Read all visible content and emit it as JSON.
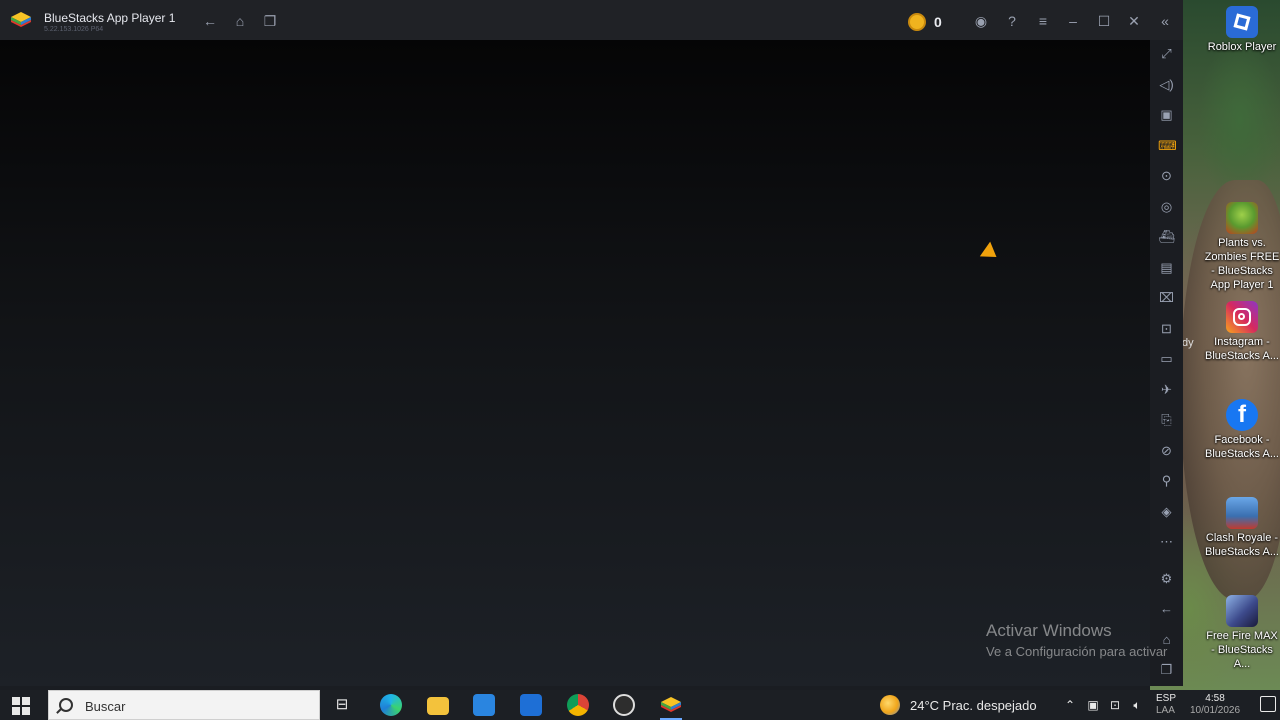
{
  "window": {
    "title": "BlueStacks App Player 1",
    "version": "5.22.153.1026 P64",
    "coin_count": "0"
  },
  "titlebar_icons": [
    "back-icon",
    "home-icon",
    "recent-apps-icon",
    "account-icon",
    "help-icon",
    "menu-icon",
    "minimize-icon",
    "maximize-icon",
    "close-icon",
    "collapse-sidebar-icon"
  ],
  "sidebar_icons": [
    "fullscreen-icon",
    "volume-icon",
    "media-manager-icon",
    "keyboard-controls-icon",
    "macro-icon",
    "sync-icon",
    "game-controls-icon",
    "apk-install-icon",
    "screenshot-icon",
    "record-icon",
    "gallery-icon",
    "airplane-mode-icon",
    "rotate-icon",
    "eco-mode-icon",
    "location-icon",
    "layers-icon",
    "more-icon",
    "settings-icon",
    "android-back-icon",
    "android-home-icon",
    "android-recent-icon"
  ],
  "desktop": {
    "icons": [
      {
        "label": "Roblox Player",
        "color": "#2a6bd6"
      },
      {
        "label": "Plants vs. Zombies FREE - BlueStacks App Player 1",
        "color": "#5a9a2f"
      },
      {
        "label": "Instagram - BlueStacks A...",
        "color": "#d6295e"
      },
      {
        "label": "Facebook - BlueStacks A...",
        "color": "#1877f2"
      },
      {
        "label": "Clash Royale - BlueStacks A...",
        "color": "#3a6fb0"
      },
      {
        "label": "Free Fire MAX - BlueStacks A...",
        "color": "#3d4a8c"
      }
    ],
    "wallpaper_fragment": "dy"
  },
  "activate_windows": {
    "title": "Activar Windows",
    "subtitle": "Ve a Configuración para activar"
  },
  "taskbar": {
    "search_placeholder": "Buscar",
    "apps": [
      "task-view-icon",
      "edge-icon",
      "file-explorer-icon",
      "store-icon",
      "mail-icon",
      "chrome-icon",
      "obs-icon",
      "bluestacks-icon"
    ],
    "weather": "24°C  Prac. despejado",
    "language": "ESP",
    "language_sub": "LAA",
    "time": "4:58",
    "date": "10/01/2026"
  },
  "colors": {
    "titlebar": "#202226",
    "sidebar": "#1b1d22",
    "coin": "#f0b31e",
    "cursor": "#f0a20c"
  }
}
